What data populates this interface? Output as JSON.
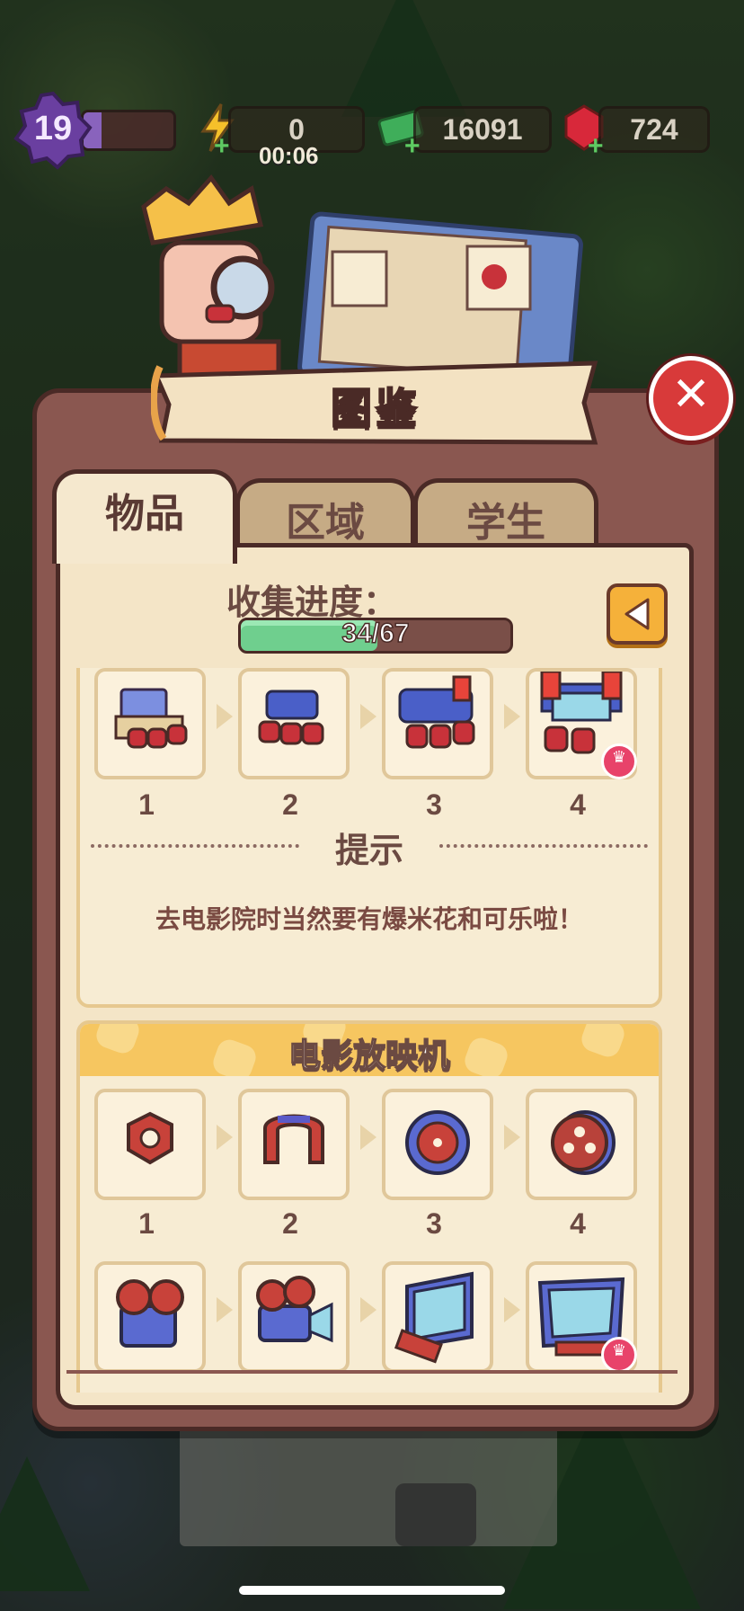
{
  "hud": {
    "level": "19",
    "energy": "0",
    "energy_timer": "00:06",
    "cash": "16091",
    "gems": "724"
  },
  "panel": {
    "title": "图鉴",
    "tabs": [
      {
        "label": "物品",
        "active": true
      },
      {
        "label": "区域",
        "active": false
      },
      {
        "label": "学生",
        "active": false
      }
    ],
    "progress": {
      "label": "收集进度：",
      "current": 34,
      "total": 67,
      "text": "34/67"
    }
  },
  "groups": [
    {
      "title": "",
      "levels": [
        "1",
        "2",
        "3",
        "4"
      ],
      "items": [
        "cinema-seats-1",
        "cinema-seats-2",
        "cinema-seats-3",
        "cinema-seats-4"
      ],
      "hint_title": "提示",
      "hint_text": "去电影院时当然要有爆米花和可乐啦！"
    },
    {
      "title": "电影放映机",
      "levels": [
        "1",
        "2",
        "3",
        "4"
      ],
      "items": [
        "hex-nut",
        "magnet-part",
        "reel-wheel",
        "film-reel",
        "projector-5",
        "projector-6",
        "screen-7",
        "screen-8"
      ]
    }
  ],
  "colors": {
    "panel": "#8a5750",
    "sheet": "#f4e5c7",
    "header_yellow": "#f6c660",
    "close_red": "#d83a3a",
    "progress_green": "#6fcf8e"
  }
}
